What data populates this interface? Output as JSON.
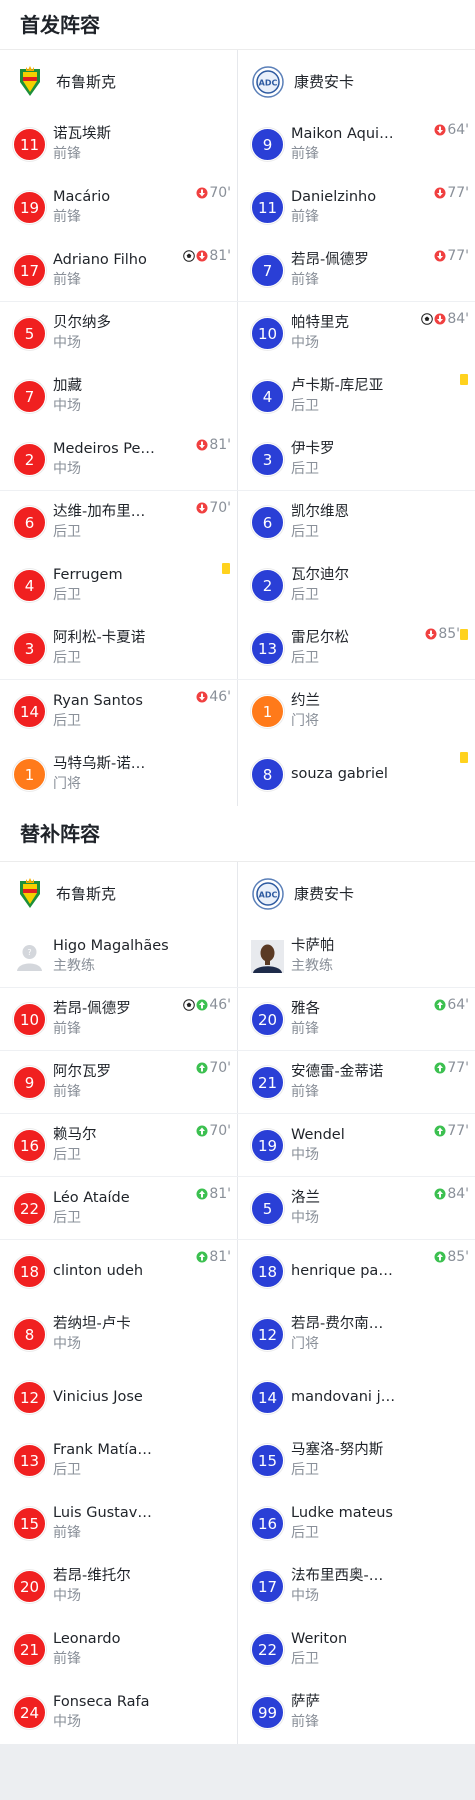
{
  "starting": {
    "title": "首发阵容",
    "home_team": "布鲁斯克",
    "away_team": "康费安卡",
    "rows": [
      {
        "home": {
          "num": "11",
          "color": "red",
          "name": "诺瓦埃斯",
          "pos": "前锋",
          "events": []
        },
        "away": {
          "num": "9",
          "color": "blue",
          "name": "Maikon Aquino",
          "pos": "前锋",
          "events": [
            {
              "type": "sub-out",
              "minute": "64'"
            }
          ]
        }
      },
      {
        "home": {
          "num": "19",
          "color": "red",
          "name": "Macário",
          "pos": "前锋",
          "events": [
            {
              "type": "sub-out",
              "minute": "70'"
            }
          ]
        },
        "away": {
          "num": "11",
          "color": "blue",
          "name": "Danielzinho",
          "pos": "前锋",
          "events": [
            {
              "type": "sub-out",
              "minute": "77'"
            }
          ]
        }
      },
      {
        "home": {
          "num": "17",
          "color": "red",
          "name": "Adriano Filho",
          "pos": "前锋",
          "events": [
            {
              "type": "goal"
            },
            {
              "type": "sub-out",
              "minute": "81'"
            }
          ]
        },
        "away": {
          "num": "7",
          "color": "blue",
          "name": "若昂-佩德罗",
          "pos": "前锋",
          "events": [
            {
              "type": "sub-out",
              "minute": "77'"
            }
          ]
        }
      },
      {
        "home": {
          "num": "5",
          "color": "red",
          "name": "贝尔纳多",
          "pos": "中场",
          "events": []
        },
        "away": {
          "num": "10",
          "color": "blue",
          "name": "帕特里克",
          "pos": "中场",
          "events": [
            {
              "type": "goal"
            },
            {
              "type": "sub-out",
              "minute": "84'"
            }
          ]
        }
      },
      {
        "home": {
          "num": "7",
          "color": "red",
          "name": "加藏",
          "pos": "中场",
          "events": []
        },
        "away": {
          "num": "4",
          "color": "blue",
          "name": "卢卡斯-库尼亚",
          "pos": "后卫",
          "events": [
            {
              "type": "yellow"
            }
          ]
        }
      },
      {
        "home": {
          "num": "2",
          "color": "red",
          "name": "Medeiros Pedro",
          "pos": "中场",
          "events": [
            {
              "type": "sub-out",
              "minute": "81'"
            }
          ]
        },
        "away": {
          "num": "3",
          "color": "blue",
          "name": "伊卡罗",
          "pos": "后卫",
          "events": []
        }
      },
      {
        "home": {
          "num": "6",
          "color": "red",
          "name": "达维-加布里…",
          "pos": "后卫",
          "events": [
            {
              "type": "sub-out",
              "minute": "70'"
            }
          ]
        },
        "away": {
          "num": "6",
          "color": "blue",
          "name": "凯尔维恩",
          "pos": "后卫",
          "events": []
        }
      },
      {
        "home": {
          "num": "4",
          "color": "red",
          "name": "Ferrugem",
          "pos": "后卫",
          "events": [
            {
              "type": "yellow"
            }
          ]
        },
        "away": {
          "num": "2",
          "color": "blue",
          "name": "瓦尔迪尔",
          "pos": "后卫",
          "events": []
        }
      },
      {
        "home": {
          "num": "3",
          "color": "red",
          "name": "阿利松-卡夏诺",
          "pos": "后卫",
          "events": []
        },
        "away": {
          "num": "13",
          "color": "blue",
          "name": "雷尼尔松",
          "pos": "后卫",
          "events": [
            {
              "type": "sub-out",
              "minute": "85'"
            },
            {
              "type": "yellow"
            }
          ]
        }
      },
      {
        "home": {
          "num": "14",
          "color": "red",
          "name": "Ryan Santos",
          "pos": "后卫",
          "events": [
            {
              "type": "sub-out",
              "minute": "46'"
            }
          ]
        },
        "away": {
          "num": "1",
          "color": "orange",
          "name": "约兰",
          "pos": "门将",
          "events": []
        }
      },
      {
        "home": {
          "num": "1",
          "color": "orange",
          "name": "马特乌斯-诺…",
          "pos": "门将",
          "events": []
        },
        "away": {
          "num": "8",
          "color": "blue",
          "name": "souza gabriel",
          "pos": "",
          "events": [
            {
              "type": "yellow"
            }
          ]
        }
      }
    ]
  },
  "subs": {
    "title": "替补阵容",
    "home_team": "布鲁斯克",
    "away_team": "康费安卡",
    "coaches": {
      "home": {
        "name": "Higo Magalhães",
        "role": "主教练"
      },
      "away": {
        "name": "卡萨帕",
        "role": "主教练"
      }
    },
    "rows": [
      {
        "home": {
          "num": "10",
          "color": "red",
          "name": "若昂-佩德罗",
          "pos": "前锋",
          "events": [
            {
              "type": "goal"
            },
            {
              "type": "sub-in",
              "minute": "46'"
            }
          ]
        },
        "away": {
          "num": "20",
          "color": "blue",
          "name": "雅各",
          "pos": "前锋",
          "events": [
            {
              "type": "sub-in",
              "minute": "64'"
            }
          ]
        }
      },
      {
        "home": {
          "num": "9",
          "color": "red",
          "name": "阿尔瓦罗",
          "pos": "前锋",
          "events": [
            {
              "type": "sub-in",
              "minute": "70'"
            }
          ]
        },
        "away": {
          "num": "21",
          "color": "blue",
          "name": "安德雷-金蒂诺",
          "pos": "前锋",
          "events": [
            {
              "type": "sub-in",
              "minute": "77'"
            }
          ]
        }
      },
      {
        "home": {
          "num": "16",
          "color": "red",
          "name": "赖马尔",
          "pos": "后卫",
          "events": [
            {
              "type": "sub-in",
              "minute": "70'"
            }
          ]
        },
        "away": {
          "num": "19",
          "color": "blue",
          "name": "Wendel",
          "pos": "中场",
          "events": [
            {
              "type": "sub-in",
              "minute": "77'"
            }
          ]
        }
      },
      {
        "home": {
          "num": "22",
          "color": "red",
          "name": "Léo Ataíde",
          "pos": "后卫",
          "events": [
            {
              "type": "sub-in",
              "minute": "81'"
            }
          ]
        },
        "away": {
          "num": "5",
          "color": "blue",
          "name": "洛兰",
          "pos": "中场",
          "events": [
            {
              "type": "sub-in",
              "minute": "84'"
            }
          ]
        }
      },
      {
        "home": {
          "num": "18",
          "color": "red",
          "name": "clinton udeh",
          "pos": "",
          "events": [
            {
              "type": "sub-in",
              "minute": "81'"
            }
          ]
        },
        "away": {
          "num": "18",
          "color": "blue",
          "name": "henrique paulo",
          "pos": "",
          "events": [
            {
              "type": "sub-in",
              "minute": "85'"
            }
          ]
        }
      },
      {
        "home": {
          "num": "8",
          "color": "red",
          "name": "若纳坦-卢卡",
          "pos": "中场",
          "events": []
        },
        "away": {
          "num": "12",
          "color": "blue",
          "name": "若昂-费尔南…",
          "pos": "门将",
          "events": []
        }
      },
      {
        "home": {
          "num": "12",
          "color": "red",
          "name": "Vinicius Jose",
          "pos": "",
          "events": []
        },
        "away": {
          "num": "14",
          "color": "blue",
          "name": "mandovani joao",
          "pos": "",
          "events": []
        }
      },
      {
        "home": {
          "num": "13",
          "color": "red",
          "name": "Frank Matías …",
          "pos": "后卫",
          "events": []
        },
        "away": {
          "num": "15",
          "color": "blue",
          "name": "马塞洛-努内斯",
          "pos": "后卫",
          "events": []
        }
      },
      {
        "home": {
          "num": "15",
          "color": "red",
          "name": "Luis Gustavo …",
          "pos": "前锋",
          "events": []
        },
        "away": {
          "num": "16",
          "color": "blue",
          "name": "Ludke mateus",
          "pos": "后卫",
          "events": []
        }
      },
      {
        "home": {
          "num": "20",
          "color": "red",
          "name": "若昂-维托尔",
          "pos": "中场",
          "events": []
        },
        "away": {
          "num": "17",
          "color": "blue",
          "name": "法布里西奥-…",
          "pos": "中场",
          "events": []
        }
      },
      {
        "home": {
          "num": "21",
          "color": "red",
          "name": "Leonardo",
          "pos": "前锋",
          "events": []
        },
        "away": {
          "num": "22",
          "color": "blue",
          "name": "Weriton",
          "pos": "后卫",
          "events": []
        }
      },
      {
        "home": {
          "num": "24",
          "color": "red",
          "name": "Fonseca Rafa",
          "pos": "中场",
          "events": []
        },
        "away": {
          "num": "99",
          "color": "blue",
          "name": "萨萨",
          "pos": "前锋",
          "events": []
        }
      }
    ]
  },
  "colors": {
    "home_number": "#f02020",
    "away_number": "#2a3fd6",
    "goalkeeper": "#ff7a1a",
    "sub_out": "#f04040",
    "sub_in": "#3cc050",
    "yellow_card": "#ffd21e"
  }
}
